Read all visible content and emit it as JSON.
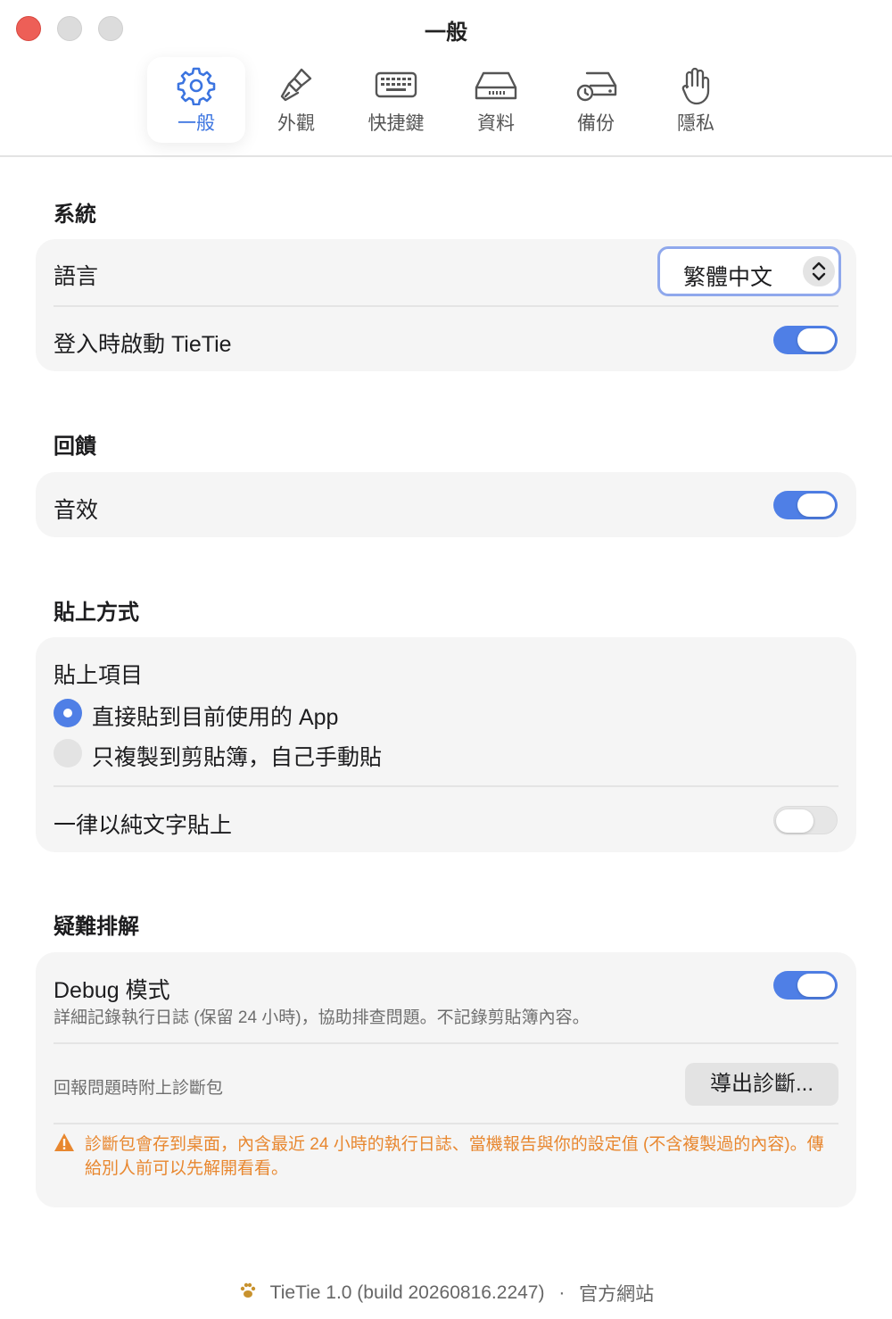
{
  "window": {
    "title": "一般"
  },
  "tabs": [
    {
      "label": "一般",
      "icon": "gear-icon",
      "active": true
    },
    {
      "label": "外觀",
      "icon": "paintbrush-icon",
      "active": false
    },
    {
      "label": "快捷鍵",
      "icon": "keyboard-icon",
      "active": false
    },
    {
      "label": "資料",
      "icon": "drive-icon",
      "active": false
    },
    {
      "label": "備份",
      "icon": "backup-drive-icon",
      "active": false
    },
    {
      "label": "隱私",
      "icon": "hand-icon",
      "active": false
    }
  ],
  "system": {
    "title": "系統",
    "language_label": "語言",
    "language_value": "繁體中文",
    "login_label": "登入時啟動 TieTie",
    "login_enabled": true
  },
  "feedback": {
    "title": "回饋",
    "sound_label": "音效",
    "sound_enabled": true
  },
  "paste": {
    "title": "貼上方式",
    "items_label": "貼上項目",
    "options": [
      {
        "label": "直接貼到目前使用的 App",
        "selected": true
      },
      {
        "label": "只複製到剪貼簿，自己手動貼",
        "selected": false
      }
    ],
    "plaintext_label": "一律以純文字貼上",
    "plaintext_enabled": false
  },
  "troubleshoot": {
    "title": "疑難排解",
    "debug_label": "Debug 模式",
    "debug_desc": "詳細記錄執行日誌 (保留 24 小時)，協助排查問題。不記錄剪貼簿內容。",
    "debug_enabled": true,
    "report_label": "回報問題時附上診斷包",
    "export_button": "導出診斷...",
    "warning": "診斷包會存到桌面，內含最近 24 小時的執行日誌、當機報告與你的設定值 (不含複製過的內容)。傳給別人前可以先解開看看。"
  },
  "footer": {
    "version": "TieTie 1.0 (build 20260816.2247)",
    "separator": "·",
    "website": "官方網站"
  },
  "colors": {
    "accent": "#4f7fe6",
    "warning": "#e8872f",
    "close": "#ed5f57"
  }
}
